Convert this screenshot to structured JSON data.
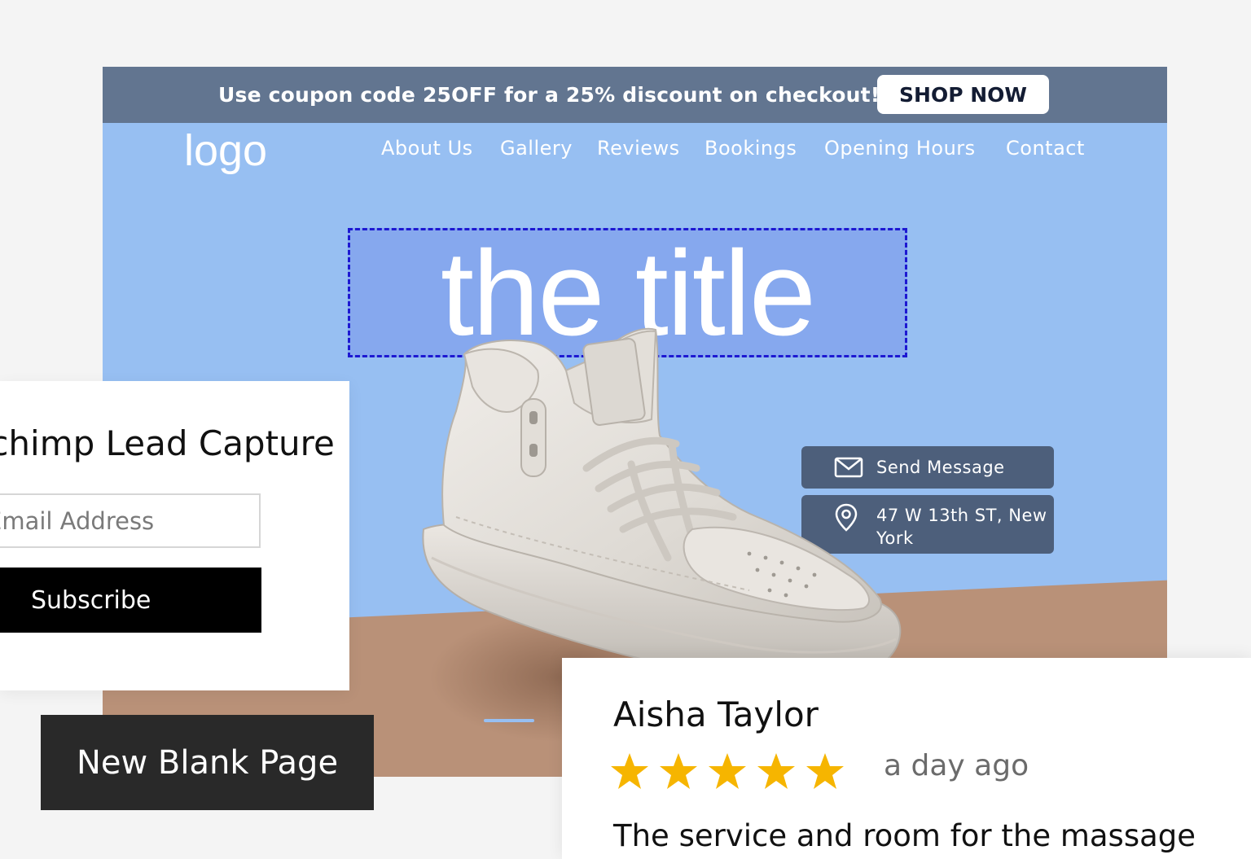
{
  "promo": {
    "text": "Use coupon code 25OFF for a 25% discount on checkout!",
    "button_label": "SHOP NOW"
  },
  "header": {
    "logo": "logo",
    "nav": [
      "About Us",
      "Gallery",
      "Reviews",
      "Bookings",
      "Opening Hours",
      "Contact"
    ]
  },
  "hero": {
    "title": "the title"
  },
  "contact": {
    "send_label": "Send Message",
    "address": "47 W 13th ST, New York",
    "send_icon": "envelope-icon",
    "address_icon": "location-pin-icon"
  },
  "lead_capture": {
    "title": "Mailchimp Lead Capture",
    "email_placeholder": "Email Address",
    "subscribe_label": "Subscribe"
  },
  "actions": {
    "new_blank_page": "New Blank Page"
  },
  "review": {
    "name": "Aisha Taylor",
    "rating": 5,
    "time": "a day ago",
    "text": "The service and room for the massage"
  },
  "colors": {
    "promo_bg": "#627590",
    "site_bg": "#97bff2",
    "ground": "#b99178",
    "chip_bg": "#4d5f7b",
    "title_outline": "#1d18d2",
    "star": "#f6b500"
  }
}
